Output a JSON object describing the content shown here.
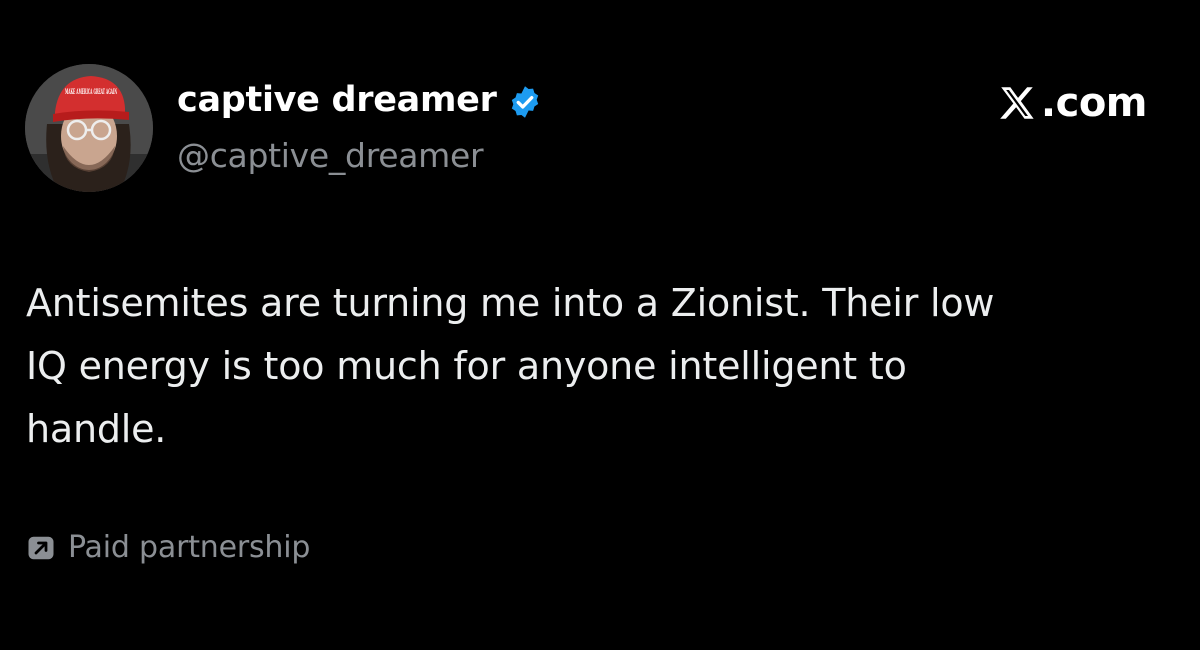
{
  "author": {
    "display_name": "captive dreamer",
    "handle": "@captive_dreamer",
    "avatar_icon": "user-avatar-red-cap-icon",
    "verified_icon": "verified-badge-icon",
    "hat_text": "MAKE AMERICA GREAT AGAIN"
  },
  "brand": {
    "icon": "x-logo-icon",
    "text": ".com"
  },
  "tweet": {
    "lines": [
      "Antisemites are turning me into a Zionist. Their low",
      "IQ energy is too much for anyone intelligent to",
      "handle."
    ]
  },
  "footer": {
    "icon": "external-link-arrow-icon",
    "label": "Paid partnership"
  },
  "colors": {
    "background": "#000000",
    "text_primary": "#ffffff",
    "text_secondary": "#8b8f94",
    "verified_blue": "#1d9bf0",
    "hat_red": "#d32f2f"
  }
}
